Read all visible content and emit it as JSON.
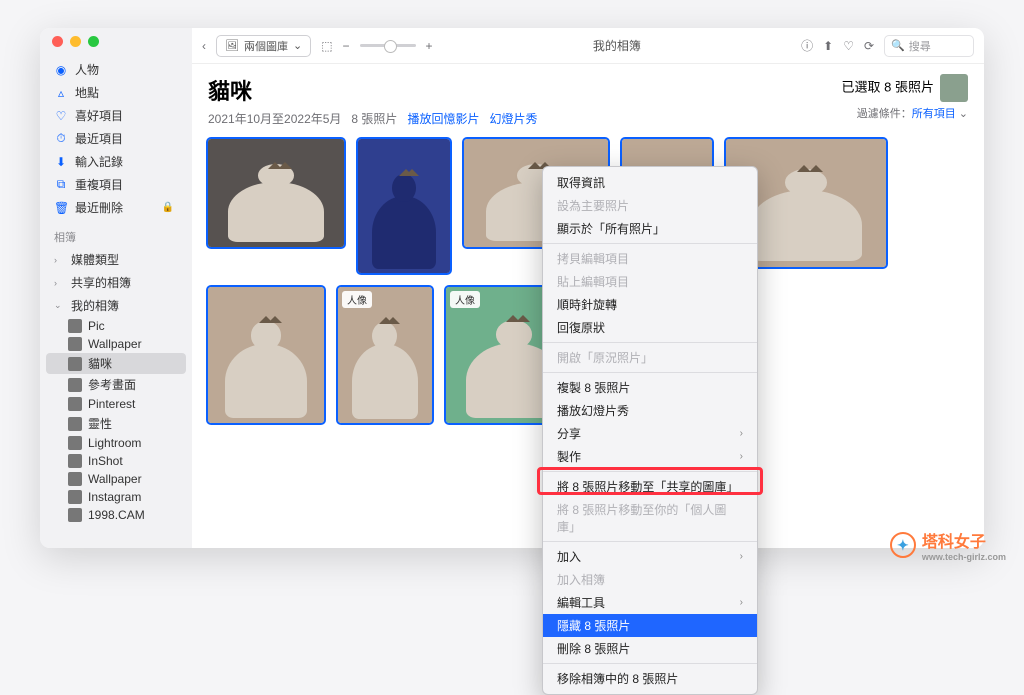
{
  "toolbar": {
    "library_pill": "兩個圖庫",
    "center_title": "我的相簿",
    "icons": {
      "info": "ⓘ",
      "share": "⬆︎",
      "heart": "♡",
      "rotate": "⟳"
    },
    "search_placeholder": "搜尋"
  },
  "sidebar": {
    "items": [
      {
        "icon": "◉",
        "label": "人物"
      },
      {
        "icon": "▵",
        "label": "地點"
      },
      {
        "icon": "♡",
        "label": "喜好項目"
      },
      {
        "icon": "⏱",
        "label": "最近項目"
      },
      {
        "icon": "⬇︎",
        "label": "輸入記錄"
      },
      {
        "icon": "⧉",
        "label": "重複項目"
      },
      {
        "icon": "🗑",
        "label": "最近刪除",
        "locked": true
      }
    ],
    "group_label": "相簿",
    "folders": [
      {
        "chev": "›",
        "label": "媒體類型"
      },
      {
        "chev": "›",
        "label": "共享的相簿"
      },
      {
        "chev": "⌄",
        "label": "我的相簿"
      }
    ],
    "albums": [
      {
        "label": "Pic"
      },
      {
        "label": "Wallpaper"
      },
      {
        "label": "貓咪",
        "selected": true
      },
      {
        "label": "參考畫面"
      },
      {
        "label": "Pinterest"
      },
      {
        "label": "靈性"
      },
      {
        "label": "Lightroom"
      },
      {
        "label": "InShot"
      },
      {
        "label": "Wallpaper"
      },
      {
        "label": "Instagram"
      },
      {
        "label": "1998.CAM"
      }
    ]
  },
  "header": {
    "title": "貓咪",
    "date_range": "2021年10月至2022年5月",
    "count": "8 張照片",
    "link_memory": "播放回憶影片",
    "link_slideshow": "幻燈片秀",
    "selection": "已選取 8 張照片",
    "filter_label": "過濾條件：",
    "filter_value": "所有項目"
  },
  "photos": {
    "portrait_tag": "人像"
  },
  "context_menu": {
    "items": [
      {
        "label": "取得資訊"
      },
      {
        "label": "設為主要照片",
        "disabled": true
      },
      {
        "label": "顯示於「所有照片」"
      },
      {
        "sep": true
      },
      {
        "label": "拷貝編輯項目",
        "disabled": true
      },
      {
        "label": "貼上編輯項目",
        "disabled": true
      },
      {
        "label": "順時針旋轉"
      },
      {
        "label": "回復原狀"
      },
      {
        "sep": true
      },
      {
        "label": "開啟「原況照片」",
        "disabled": true
      },
      {
        "sep": true
      },
      {
        "label": "複製 8 張照片"
      },
      {
        "label": "播放幻燈片秀"
      },
      {
        "label": "分享",
        "submenu": true
      },
      {
        "label": "製作",
        "submenu": true
      },
      {
        "sep": true
      },
      {
        "label": "將 8 張照片移動至「共享的圖庫」"
      },
      {
        "label": "將 8 張照片移動至你的「個人圖庫」",
        "disabled": true
      },
      {
        "sep": true
      },
      {
        "label": "加入",
        "submenu": true
      },
      {
        "label": "加入相簿",
        "disabled": true
      },
      {
        "label": "編輯工具",
        "submenu": true
      },
      {
        "label": "隱藏 8 張照片",
        "highlight": true
      },
      {
        "label": "刪除 8 張照片"
      },
      {
        "sep": true
      },
      {
        "label": "移除相簿中的 8 張照片"
      }
    ]
  },
  "watermark": {
    "text": "塔科女子",
    "url": "www.tech-girlz.com"
  }
}
